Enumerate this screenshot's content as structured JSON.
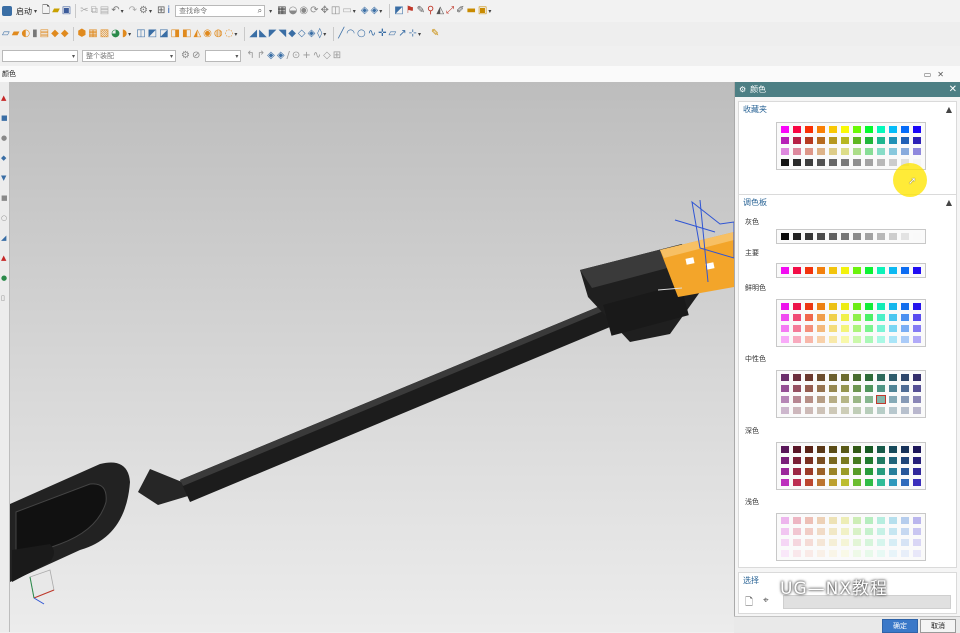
{
  "toolbar": {
    "start_label": "启动",
    "command_search_placeholder": "查找命令",
    "filter1": "整个装配",
    "filter2": "",
    "filter3": "",
    "row1_icons": [
      "new-file-icon",
      "open-folder-icon",
      "save-icon",
      "cut-icon",
      "copy-icon",
      "paste-icon",
      "undo-icon",
      "redo-icon",
      "touch-mode-icon",
      "window-icon"
    ],
    "row2_icons": [
      "sketch-icon",
      "extrude-icon",
      "revolve-icon",
      "hole-icon",
      "boss-icon",
      "pocket-icon",
      "pad-icon",
      "slot-icon",
      "groove-icon",
      "thread-icon",
      "edge-blend-icon",
      "chamfer-icon",
      "shell-icon",
      "draft-icon",
      "pattern-icon",
      "mirror-icon",
      "trim-body-icon",
      "split-body-icon",
      "unite-icon",
      "subtract-icon",
      "intersect-icon",
      "offset-face-icon",
      "scale-icon",
      "sew-icon",
      "patch-icon",
      "surface-icon",
      "thicken-icon",
      "sweep-icon",
      "loft-icon",
      "line-icon",
      "arc-icon",
      "circle-icon",
      "spline-icon",
      "point-icon",
      "plane-icon",
      "axis-icon",
      "csys-icon",
      "measure-icon"
    ]
  },
  "tab_label": "颜色",
  "panel": {
    "title": "颜色",
    "favorites_header": "收藏夹",
    "palette_header": "调色板",
    "labels": {
      "gray": "灰色",
      "main": "主要",
      "vivid": "鲜明色",
      "neutral": "中性色",
      "dark": "深色",
      "light": "浅色"
    },
    "select_header": "选择",
    "ok_button": "确定",
    "cancel_button": "取消"
  },
  "colors": {
    "panel_title_bg": "#4d7f84",
    "section_header_text": "#2a6496",
    "plug_orange": "#f3a52a",
    "cable_black": "#1a1a1a",
    "highlight_yellow": "#ffe600"
  },
  "watermark": "UG—NX教程"
}
